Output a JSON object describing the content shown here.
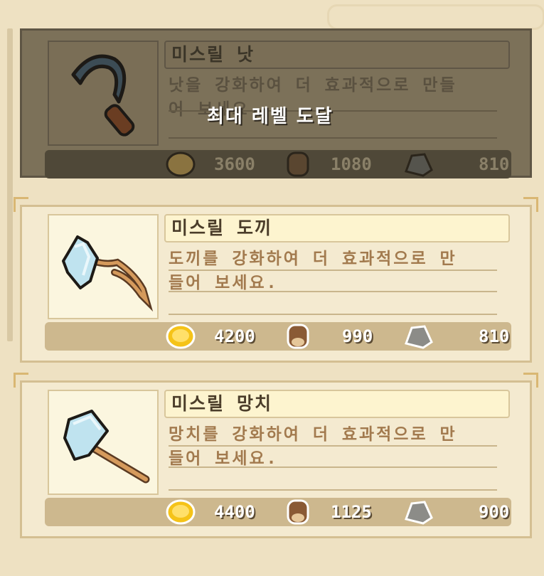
{
  "colors": {
    "panel_bg": "#eee1c2",
    "card_bg": "#f4ead0",
    "maxed_bg": "#7c7159",
    "cost_bar": "#cdb88e"
  },
  "upgrades": [
    {
      "title": "미스릴 낫",
      "description_line1": "낫을 강화하여 더 효과적으로 만들",
      "description_line2": "어 보세요.",
      "icon": "sickle-icon",
      "status_overlay": "최대 레벨 도달",
      "maxed": true,
      "costs": {
        "gold": "3600",
        "wood": "1080",
        "stone": "810"
      }
    },
    {
      "title": "미스릴 도끼",
      "description_line1": "도끼를 강화하여 더 효과적으로 만",
      "description_line2": "들어 보세요.",
      "icon": "axe-icon",
      "maxed": false,
      "costs": {
        "gold": "4200",
        "wood": "990",
        "stone": "810"
      }
    },
    {
      "title": "미스릴 망치",
      "description_line1": "망치를 강화하여 더 효과적으로 만",
      "description_line2": "들어 보세요.",
      "icon": "hammer-icon",
      "maxed": false,
      "costs": {
        "gold": "4400",
        "wood": "1125",
        "stone": "900"
      }
    }
  ],
  "resource_icons": [
    "gold-coin-icon",
    "wood-log-icon",
    "stone-icon"
  ]
}
